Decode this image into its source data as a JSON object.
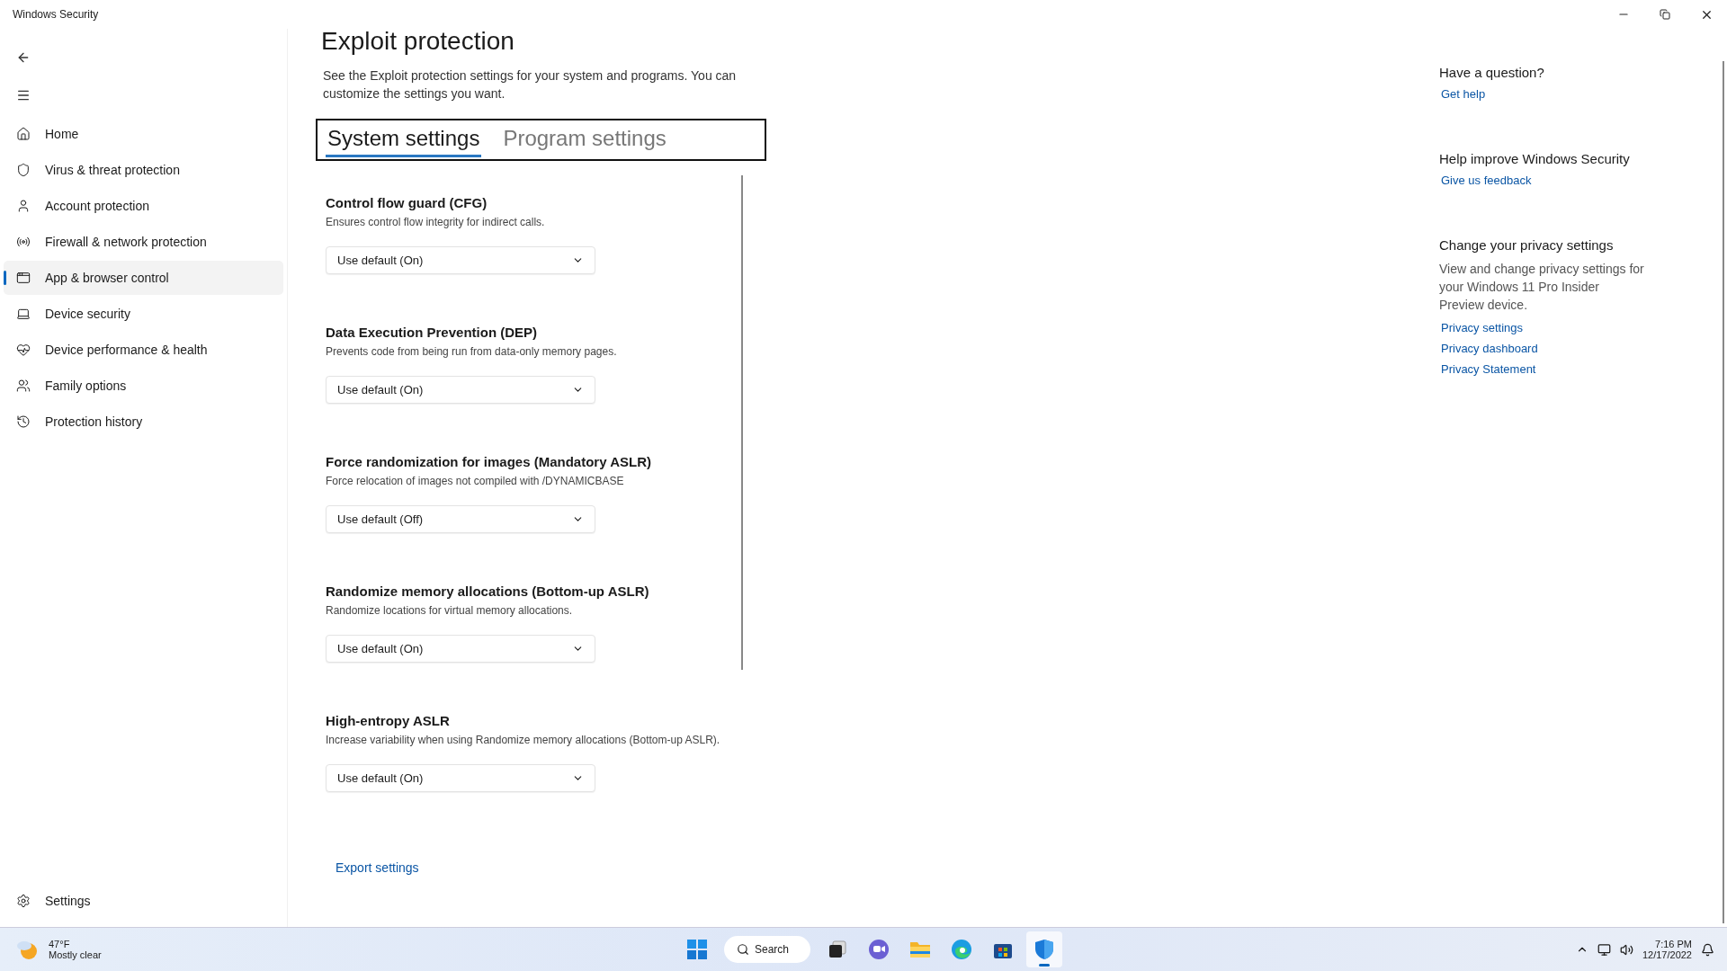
{
  "window": {
    "title": "Windows Security"
  },
  "sidebar": {
    "items": [
      {
        "label": "Home",
        "selected": false
      },
      {
        "label": "Virus & threat protection",
        "selected": false
      },
      {
        "label": "Account protection",
        "selected": false
      },
      {
        "label": "Firewall & network protection",
        "selected": false
      },
      {
        "label": "App & browser control",
        "selected": true
      },
      {
        "label": "Device security",
        "selected": false
      },
      {
        "label": "Device performance & health",
        "selected": false
      },
      {
        "label": "Family options",
        "selected": false
      },
      {
        "label": "Protection history",
        "selected": false
      }
    ],
    "footer": {
      "label": "Settings"
    }
  },
  "page": {
    "title": "Exploit protection",
    "description": "See the Exploit protection settings for your system and programs.  You can customize the settings you want.",
    "tabs": [
      {
        "label": "System settings",
        "selected": true
      },
      {
        "label": "Program settings",
        "selected": false
      }
    ],
    "settings": [
      {
        "title": "Control flow guard (CFG)",
        "description": "Ensures control flow integrity for indirect calls.",
        "value": "Use default (On)"
      },
      {
        "title": "Data Execution Prevention (DEP)",
        "description": "Prevents code from being run from data-only memory pages.",
        "value": "Use default (On)"
      },
      {
        "title": "Force randomization for images (Mandatory ASLR)",
        "description": "Force relocation of images not compiled with /DYNAMICBASE",
        "value": "Use default (Off)"
      },
      {
        "title": "Randomize memory allocations (Bottom-up ASLR)",
        "description": "Randomize locations for virtual memory allocations.",
        "value": "Use default (On)"
      },
      {
        "title": "High-entropy ASLR",
        "description": "Increase variability when using Randomize memory allocations (Bottom-up ASLR).",
        "value": "Use default (On)"
      }
    ],
    "export_link": "Export settings"
  },
  "side_panel": [
    {
      "heading": "Have a question?",
      "links": [
        "Get help"
      ]
    },
    {
      "heading": "Help improve Windows Security",
      "links": [
        "Give us feedback"
      ]
    },
    {
      "heading": "Change your privacy settings",
      "text": "View and change privacy settings for your Windows 11 Pro Insider Preview device.",
      "links": [
        "Privacy settings",
        "Privacy dashboard",
        "Privacy Statement"
      ]
    }
  ],
  "taskbar": {
    "weather": {
      "temperature": "47°F",
      "condition": "Mostly clear"
    },
    "search": "Search",
    "apps": [
      {
        "kind": "start",
        "selected": false
      },
      {
        "kind": "search",
        "selected": false
      },
      {
        "kind": "taskview",
        "selected": false
      },
      {
        "kind": "chat",
        "selected": false
      },
      {
        "kind": "explorer",
        "selected": false
      },
      {
        "kind": "edge",
        "selected": false
      },
      {
        "kind": "store",
        "selected": false
      },
      {
        "kind": "security",
        "selected": true
      }
    ],
    "time": "7:16 PM",
    "date": "12/17/2022"
  }
}
